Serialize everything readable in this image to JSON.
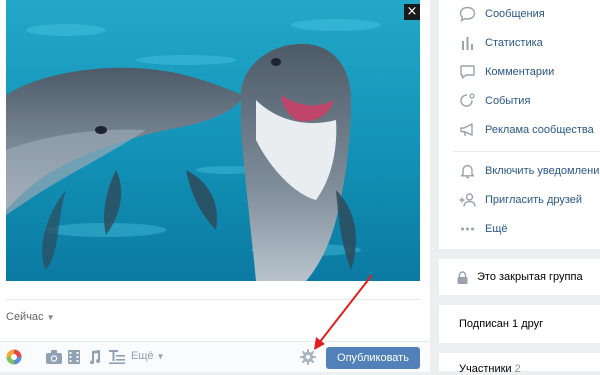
{
  "post": {
    "close_label": "×",
    "time_label": "Сейчас",
    "more_label": "Ещё",
    "publish_label": "Опубликовать"
  },
  "sidebar": {
    "items": [
      {
        "label": "Сообщения",
        "icon": "message-icon"
      },
      {
        "label": "Статистика",
        "icon": "stats-icon"
      },
      {
        "label": "Комментарии",
        "icon": "comment-icon"
      },
      {
        "label": "События",
        "icon": "events-icon"
      },
      {
        "label": "Реклама сообщества",
        "icon": "megaphone-icon"
      },
      {
        "label": "Включить уведомлени",
        "icon": "bell-icon"
      },
      {
        "label": "Пригласить друзей",
        "icon": "add-friend-icon"
      },
      {
        "label": "Ещё",
        "icon": "more-dots-icon"
      }
    ],
    "closed_group": "Это закрытая группа",
    "subscribed": "Подписан 1 друг",
    "members_label": "Участники",
    "members_count": "2"
  },
  "colors": {
    "accent": "#5181b8",
    "link": "#2a5885",
    "annotation_arrow": "#e02020"
  }
}
